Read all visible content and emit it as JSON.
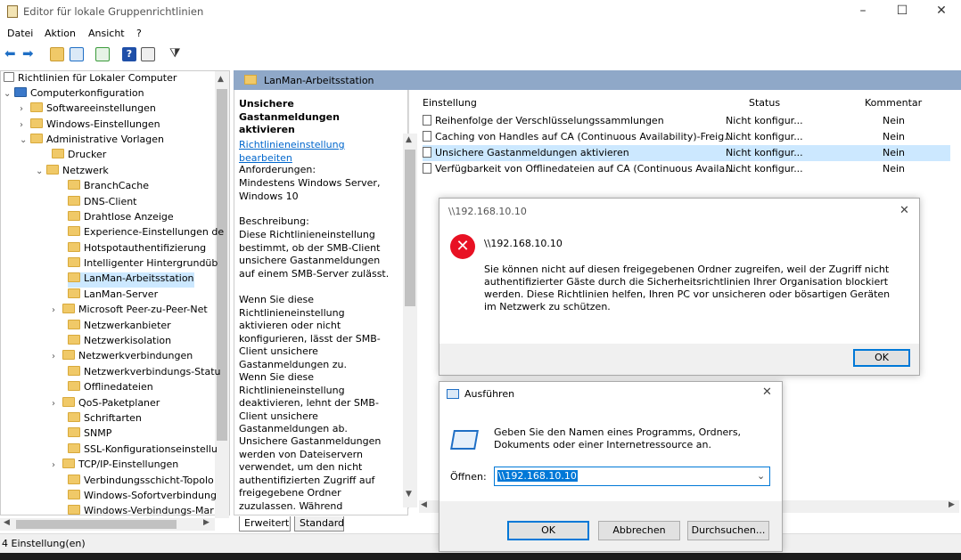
{
  "window": {
    "title": "Editor für lokale Gruppenrichtlinien"
  },
  "menu": [
    "Datei",
    "Aktion",
    "Ansicht",
    "?"
  ],
  "tree": {
    "items": [
      {
        "label": "Richtlinien für Lokaler Computer"
      },
      {
        "label": "Computerkonfiguration"
      },
      {
        "label": "Softwareeinstellungen"
      },
      {
        "label": "Windows-Einstellungen"
      },
      {
        "label": "Administrative Vorlagen"
      },
      {
        "label": "Drucker"
      },
      {
        "label": "Netzwerk"
      },
      {
        "label": "BranchCache"
      },
      {
        "label": "DNS-Client"
      },
      {
        "label": "Drahtlose Anzeige"
      },
      {
        "label": "Experience-Einstellungen de"
      },
      {
        "label": "Hotspotauthentifizierung"
      },
      {
        "label": "Intelligenter Hintergrundüb"
      },
      {
        "label": "LanMan-Arbeitsstation"
      },
      {
        "label": "LanMan-Server"
      },
      {
        "label": "Microsoft Peer-zu-Peer-Net"
      },
      {
        "label": "Netzwerkanbieter"
      },
      {
        "label": "Netzwerkisolation"
      },
      {
        "label": "Netzwerkverbindungen"
      },
      {
        "label": "Netzwerkverbindungs-Statu"
      },
      {
        "label": "Offlinedateien"
      },
      {
        "label": "QoS-Paketplaner"
      },
      {
        "label": "Schriftarten"
      },
      {
        "label": "SNMP"
      },
      {
        "label": "SSL-Konfigurationseinstellu"
      },
      {
        "label": "TCP/IP-Einstellungen"
      },
      {
        "label": "Verbindungsschicht-Topolo"
      },
      {
        "label": "Windows-Sofortverbindung"
      },
      {
        "label": "Windows-Verbindungs-Mar"
      }
    ]
  },
  "middle": {
    "header": "LanMan-Arbeitsstation",
    "policy_title": "Unsichere Gastanmeldungen aktivieren",
    "edit_link": "Richtlinieneinstellung bearbeiten",
    "req_label": "Anforderungen:",
    "req_text": "Mindestens Windows Server, Windows 10",
    "desc_label": "Beschreibung:",
    "desc_text": "Diese Richtlinieneinstellung bestimmt, ob der SMB-Client unsichere Gastanmeldungen auf einem SMB-Server zulässt.",
    "p2": "Wenn Sie diese Richtlinieneinstellung aktivieren oder nicht konfigurieren, lässt der SMB-Client unsichere Gastanmeldungen zu.",
    "p3": "Wenn Sie diese Richtlinieneinstellung deaktivieren, lehnt der SMB-Client unsichere Gastanmeldungen ab.",
    "p4": "Unsichere Gastanmeldungen werden von Dateiservern verwendet, um den nicht authentifizierten Zugriff auf freigegebene Ordner zuzulassen. Während unsichere"
  },
  "list": {
    "headers": {
      "setting": "Einstellung",
      "status": "Status",
      "comment": "Kommentar"
    },
    "rows": [
      {
        "setting": "Reihenfolge der Verschlüsselungssammlungen",
        "status": "Nicht konfigur...",
        "comment": "Nein"
      },
      {
        "setting": "Caching von Handles auf CA (Continuous Availability)-Freig...",
        "status": "Nicht konfigur...",
        "comment": "Nein"
      },
      {
        "setting": "Unsichere Gastanmeldungen aktivieren",
        "status": "Nicht konfigur...",
        "comment": "Nein"
      },
      {
        "setting": "Verfügbarkeit von Offlinedateien auf CA (Continuous Availa...",
        "status": "Nicht konfigur...",
        "comment": "Nein"
      }
    ]
  },
  "tabs": [
    "Erweitert",
    "Standard"
  ],
  "status": "4 Einstellung(en)",
  "error_dialog": {
    "title": "\\\\192.168.10.10",
    "heading": "\\\\192.168.10.10",
    "message": "Sie können nicht auf diesen freigegebenen Ordner zugreifen, weil der Zugriff nicht authentifizierter Gäste durch die Sicherheitsrichtlinien Ihrer Organisation blockiert werden. Diese Richtlinien helfen, Ihren PC vor unsicheren oder bösartigen Geräten im Netzwerk zu schützen.",
    "ok": "OK"
  },
  "run_dialog": {
    "title": "Ausführen",
    "prompt": "Geben Sie den Namen eines Programms, Ordners, Dokuments oder einer Internetressource an.",
    "open_label": "Öffnen:",
    "value": "\\\\192.168.10.10",
    "ok": "OK",
    "cancel": "Abbrechen",
    "browse": "Durchsuchen..."
  }
}
